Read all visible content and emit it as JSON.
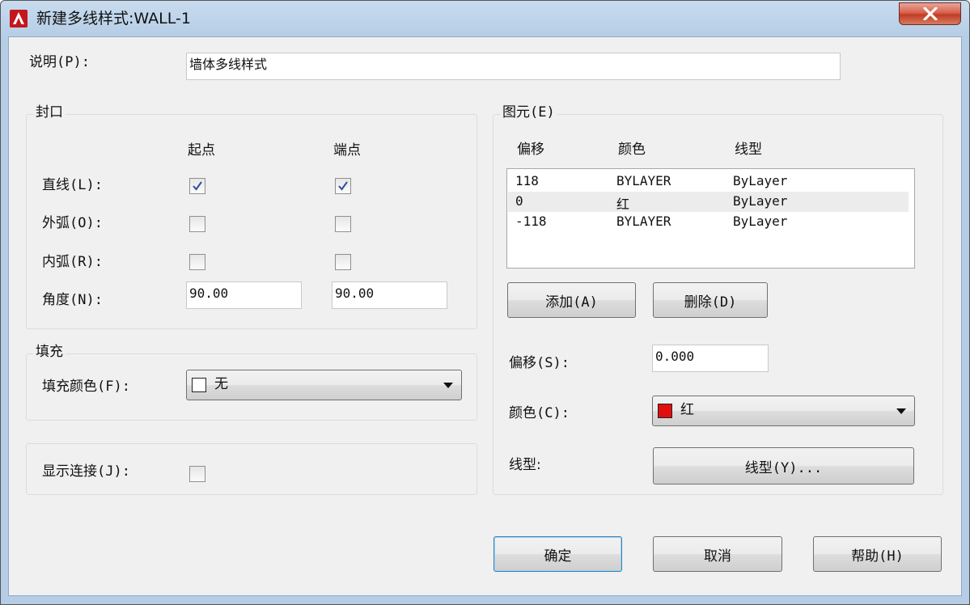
{
  "window": {
    "title": "新建多线样式:WALL-1"
  },
  "description": {
    "label": "说明(P):",
    "value": "墙体多线样式"
  },
  "caps": {
    "group_title": "封口",
    "col_start": "起点",
    "col_end": "端点",
    "rows": [
      {
        "label": "直线(L):",
        "start_checked": true,
        "end_checked": true
      },
      {
        "label": "外弧(O):",
        "start_checked": false,
        "end_checked": false
      },
      {
        "label": "内弧(R):",
        "start_checked": false,
        "end_checked": false
      }
    ],
    "angle_label": "角度(N):",
    "angle_start": "90.00",
    "angle_end": "90.00"
  },
  "fill": {
    "group_title": "填充",
    "label": "填充颜色(F):",
    "value": "无",
    "swatch_color": "#ffffff"
  },
  "joints": {
    "label": "显示连接(J):",
    "checked": false
  },
  "elements": {
    "group_title": "图元(E)",
    "headers": {
      "offset": "偏移",
      "color": "颜色",
      "linetype": "线型"
    },
    "rows": [
      {
        "offset": "118",
        "color": "BYLAYER",
        "linetype": "ByLayer"
      },
      {
        "offset": "0",
        "color": "红",
        "linetype": "ByLayer"
      },
      {
        "offset": "-118",
        "color": "BYLAYER",
        "linetype": "ByLayer"
      }
    ],
    "add_button": "添加(A)",
    "delete_button": "删除(D)",
    "offset_label": "偏移(S):",
    "offset_value": "0.000",
    "color_label": "颜色(C):",
    "color_value": "红",
    "color_swatch": "#e01010",
    "linetype_label": "线型:",
    "linetype_button": "线型(Y)..."
  },
  "footer": {
    "ok": "确定",
    "cancel": "取消",
    "help": "帮助(H)"
  }
}
